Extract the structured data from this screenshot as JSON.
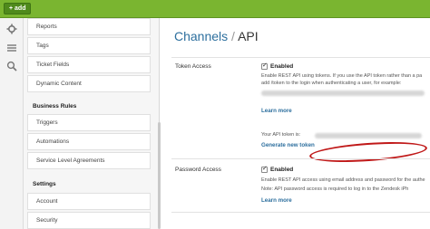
{
  "topbar": {
    "new_label": "+ add"
  },
  "breadcrumb": {
    "parent": "Channels",
    "separator": "/",
    "current": "API"
  },
  "sidebar": {
    "items_top": [
      "Reports",
      "Tags",
      "Ticket Fields",
      "Dynamic Content"
    ],
    "business_rules_heading": "Business Rules",
    "business_rules_items": [
      "Triggers",
      "Automations",
      "Service Level Agreements"
    ],
    "settings_heading": "Settings",
    "settings_items": [
      "Account",
      "Security"
    ]
  },
  "token_access": {
    "label": "Token Access",
    "enabled_label": "Enabled",
    "desc_line1": "Enable REST API using tokens. If you use the API token rather than a pa",
    "desc_line2": "add /token to the login when authenticating a user, for example:",
    "learn_more": "Learn more",
    "your_token_label": "Your API token is:",
    "generate_link": "Generate new token"
  },
  "password_access": {
    "label": "Password Access",
    "enabled_label": "Enabled",
    "desc_line1": "Enable REST API access using email address and password for the authe",
    "desc_line2": "Note: API password access is required to log in to the Zendesk iPh",
    "learn_more": "Learn more"
  },
  "colors": {
    "brand_green": "#7ab530",
    "link_blue": "#2d6f9e",
    "highlight_red": "#c01818"
  }
}
